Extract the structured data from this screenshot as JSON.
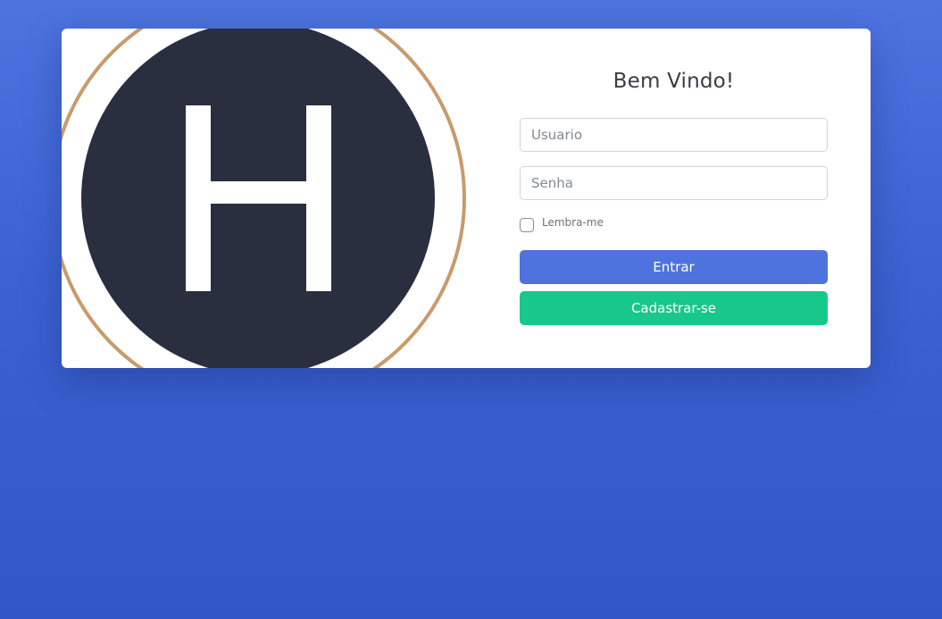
{
  "logo": {
    "letter": "H",
    "colors": {
      "circle": "#2a2f3f",
      "ring": "#c99a6b",
      "letter": "#ffffff"
    }
  },
  "login": {
    "heading": "Bem Vindo!",
    "username_placeholder": "Usuario",
    "password_placeholder": "Senha",
    "remember_label": "Lembra-me",
    "remember_checked": false,
    "login_button": "Entrar",
    "register_button": "Cadastrar-se"
  },
  "colors": {
    "background": "#4e73df",
    "primary": "#4e73df",
    "success": "#17c78b"
  }
}
